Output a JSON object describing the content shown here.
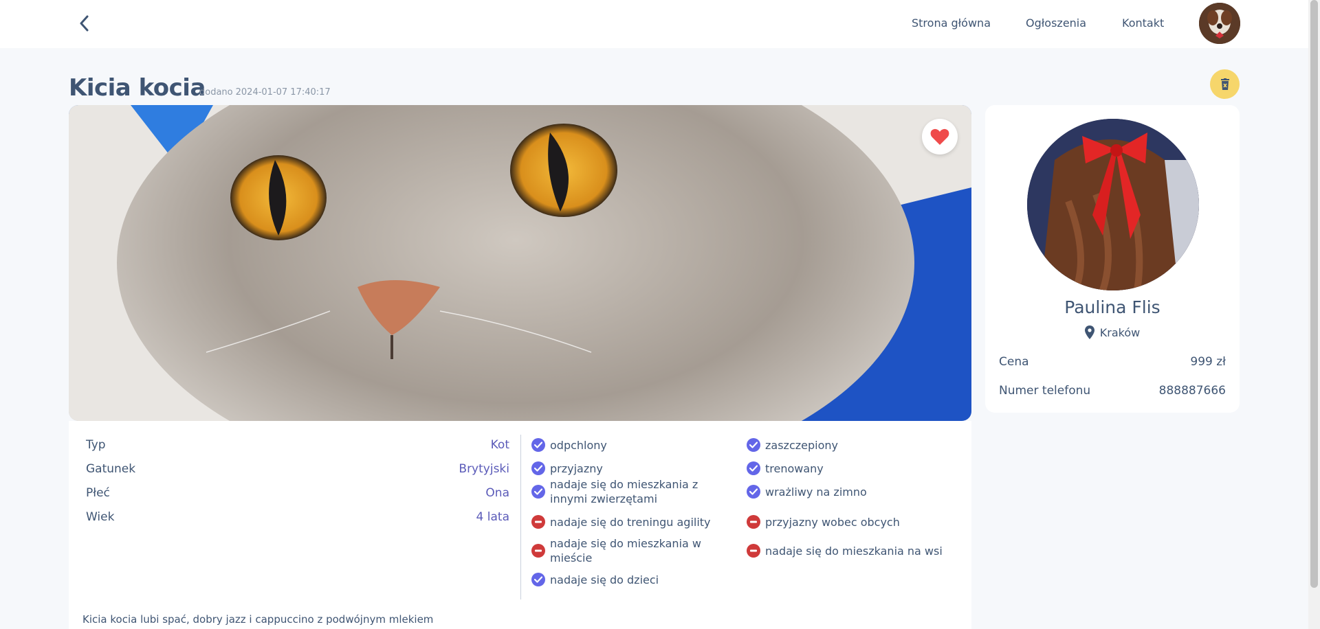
{
  "header": {
    "nav": [
      "Strona główna",
      "Ogłoszenia",
      "Kontakt"
    ]
  },
  "listing": {
    "title": "Kicia kocia",
    "added_label": "dodano",
    "added_date": "2024-01-07 17:40:17",
    "attributes": [
      {
        "label": "Typ",
        "value": "Kot"
      },
      {
        "label": "Gatunek",
        "value": "Brytyjski"
      },
      {
        "label": "Płeć",
        "value": "Ona"
      },
      {
        "label": "Wiek",
        "value": "4 lata"
      }
    ],
    "traits": [
      {
        "text": "odpchlony",
        "ok": true
      },
      {
        "text": "zaszczepiony",
        "ok": true
      },
      {
        "text": "przyjazny",
        "ok": true
      },
      {
        "text": "trenowany",
        "ok": true
      },
      {
        "text": "nadaje się do mieszkania z innymi zwierzętami",
        "ok": true
      },
      {
        "text": "wrażliwy na zimno",
        "ok": true
      },
      {
        "text": "nadaje się do treningu agility",
        "ok": false
      },
      {
        "text": "przyjazny wobec obcych",
        "ok": false
      },
      {
        "text": "nadaje się do mieszkania w mieście",
        "ok": false
      },
      {
        "text": "nadaje się do mieszkania na wsi",
        "ok": false
      },
      {
        "text": "nadaje się do dzieci",
        "ok": true
      }
    ],
    "description": "Kicia kocia lubi spać, dobry jazz i cappuccino z podwójnym mlekiem"
  },
  "seller": {
    "name": "Paulina Flis",
    "location": "Kraków",
    "price_label": "Cena",
    "price": "999 zł",
    "phone_label": "Numer telefonu",
    "phone": "888887666"
  },
  "colors": {
    "accent": "#6366e8",
    "negative": "#cf3a3a",
    "delete": "#f6d66b",
    "heart": "#ef4b4b",
    "text": "#3f5573"
  },
  "icons": {
    "back": "chevron-left-icon",
    "delete": "trash-icon",
    "favorite": "heart-icon",
    "location": "map-pin-icon",
    "positive": "check-circle-icon",
    "negative": "minus-circle-icon"
  }
}
